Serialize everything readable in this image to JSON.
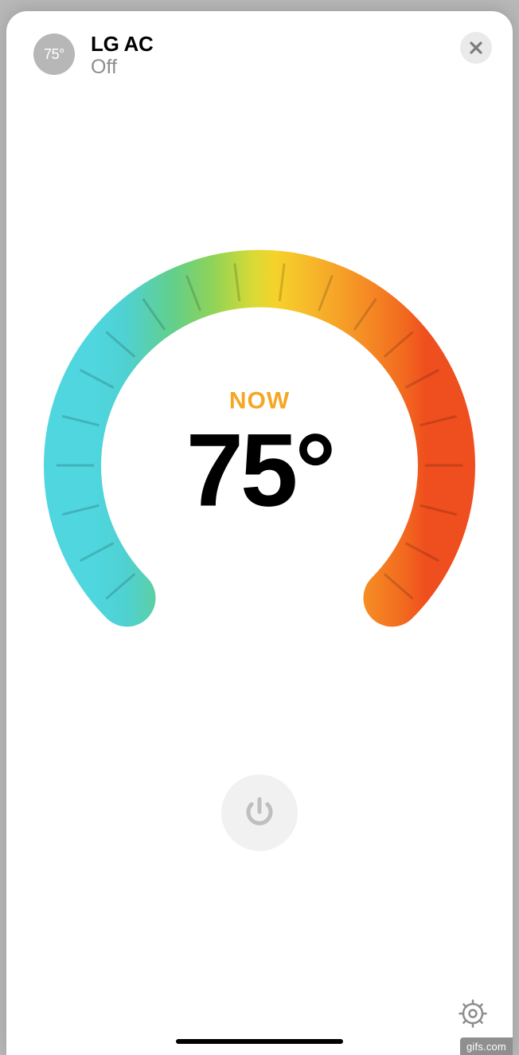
{
  "header": {
    "chip_label": "75°",
    "title": "LG AC",
    "subtitle": "Off"
  },
  "dial": {
    "now_label": "NOW",
    "temperature": "75°"
  },
  "icons": {
    "close": "close-icon",
    "power": "power-icon",
    "settings": "gear-icon"
  },
  "watermark": "gifs.com"
}
